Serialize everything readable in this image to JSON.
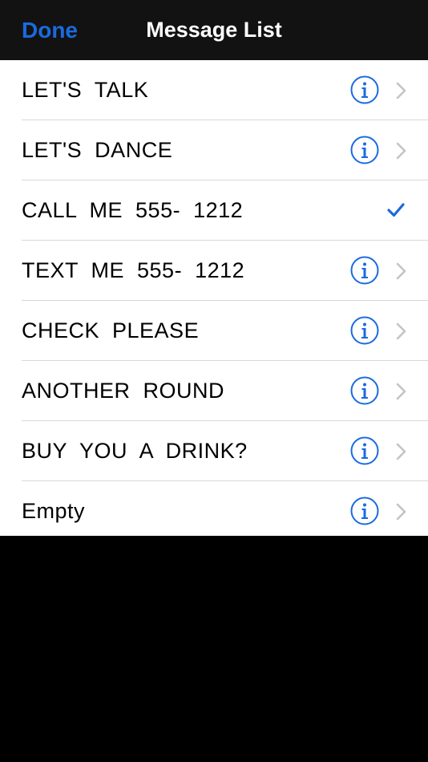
{
  "nav": {
    "done_label": "Done",
    "title": "Message List"
  },
  "colors": {
    "accent": "#1a6ae0",
    "nav_background": "#121212",
    "chevron": "#c4c4c8"
  },
  "rows": [
    {
      "label": "LET'S  TALK",
      "accessory": "info-chevron"
    },
    {
      "label": "LET'S  DANCE",
      "accessory": "info-chevron"
    },
    {
      "label": "CALL  ME  555-  1212",
      "accessory": "checkmark"
    },
    {
      "label": "TEXT  ME  555-  1212",
      "accessory": "info-chevron"
    },
    {
      "label": "CHECK  PLEASE",
      "accessory": "info-chevron"
    },
    {
      "label": "ANOTHER  ROUND",
      "accessory": "info-chevron"
    },
    {
      "label": "BUY  YOU  A  DRINK?",
      "accessory": "info-chevron"
    },
    {
      "label": "Empty",
      "accessory": "info-chevron"
    }
  ]
}
